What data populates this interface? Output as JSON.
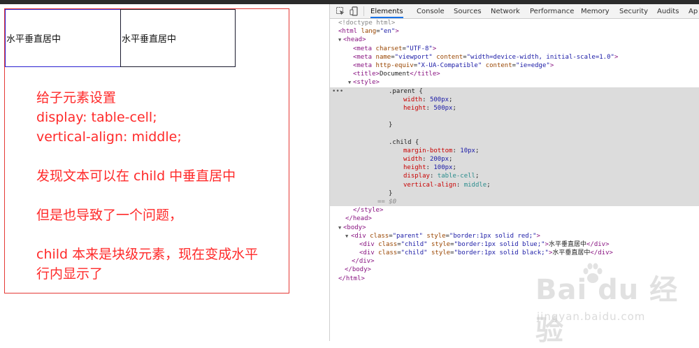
{
  "preview": {
    "child_1_text": "水平垂直居中",
    "child_2_text": "水平垂直居中",
    "note": {
      "l1": "给子元素设置",
      "l2": "display: table-cell;",
      "l3": "vertical-align: middle;",
      "l4": "发现文本可以在 child 中垂直居中",
      "l5": "但是也导致了一个问题，",
      "l6": "child 本来是块级元素，现在变成水平",
      "l7": "行内显示了"
    }
  },
  "devtools": {
    "tabs": [
      "Elements",
      "Console",
      "Sources",
      "Network",
      "Performance",
      "Memory",
      "Security",
      "Audits",
      "Ap"
    ],
    "active_tab": "Elements",
    "code": {
      "doctype": "<!doctype html>",
      "html_tag": "html",
      "html_lang_attr": "lang",
      "html_lang_val": "\"en\"",
      "head_tag": "head",
      "meta_tag": "meta",
      "charset_attr": "charset",
      "charset_val": "\"UTF-8\"",
      "name_attr": "name",
      "name_val": "\"viewport\"",
      "content_attr": "content",
      "content_val_1": "\"width=device-width, initial-scale=1.0\"",
      "http_equiv_attr": "http-equiv",
      "http_equiv_val": "\"X-UA-Compatible\"",
      "content_val_2": "\"ie=edge\"",
      "title_tag": "title",
      "title_text": "Document",
      "style_tag": "style",
      "sel_parent": ".parent {",
      "p_width_prop": "width",
      "p_width_val": "500px",
      "p_height_prop": "height",
      "p_height_val": "500px",
      "close_brace": "}",
      "sel_child": ".child {",
      "c_mb_prop": "margin-bottom",
      "c_mb_val": "10px",
      "c_width_prop": "width",
      "c_width_val": "200px",
      "c_height_prop": "height",
      "c_height_val": "100px",
      "c_display_prop": "display",
      "c_display_val": "table-cell",
      "c_va_prop": "vertical-align",
      "c_va_val": "middle",
      "eq_marker": "== $0",
      "body_tag": "body",
      "div_tag": "div",
      "class_attr": "class",
      "style_attr": "style",
      "parent_class_val": "\"parent\"",
      "parent_style_val": "\"border:1px solid red;\"",
      "child_class_val": "\"child\"",
      "child1_style_val": "\"border:1px solid blue;\"",
      "child2_style_val": "\"border:1px solid black;\"",
      "child_text": "水平垂直居中"
    }
  },
  "watermark": {
    "logo": "Bai du 经验",
    "sub": "jingyan.baidu.com"
  }
}
